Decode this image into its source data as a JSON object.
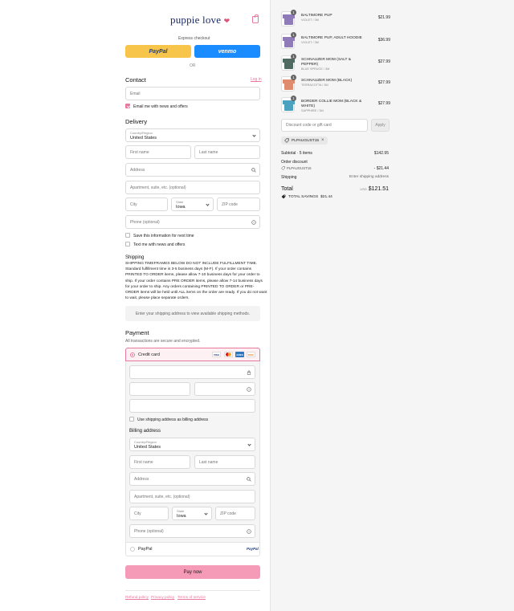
{
  "header": {
    "logo": "puppie love",
    "paw": "❤"
  },
  "express": {
    "label": "Express checkout",
    "paypal": "PayPal",
    "venmo": "venmo",
    "or": "OR"
  },
  "contact": {
    "title": "Contact",
    "login": "Log in",
    "email_placeholder": "Email",
    "newsletter": "Email me with news and offers"
  },
  "delivery": {
    "title": "Delivery",
    "country_label": "Country/Region",
    "country": "United States",
    "first": "First name",
    "last": "Last name",
    "address": "Address",
    "apt": "Apartment, suite, etc. (optional)",
    "city": "City",
    "state_label": "State",
    "state": "Iowa",
    "zip": "ZIP code",
    "phone": "Phone (optional)",
    "save_info": "Save this information for next time",
    "text_me": "Text me with news and offers"
  },
  "shipping": {
    "title": "Shipping",
    "notice_lines": [
      "SHIPPING TIMEFRAMES BELOW DO NOT INCLUDE FULFILLMENT TIME.",
      "Standard fulfillment time is 3-5 business days (M-F). If your order contains",
      "PRINTED TO ORDER items, please allow 7-10 business days for your order to",
      "ship. If your order contains PRE ORDER items, please allow 7-14 business days",
      "for your order to ship. Any orders containing PRINTED TO ORDER or PRE-",
      "ORDER items will be held until ALL items on the order are ready. If you do not want",
      "to wait, please place separate orders."
    ],
    "placeholder": "Enter your shipping address to view available shipping methods."
  },
  "payment": {
    "title": "Payment",
    "subtitle": "All transactions are secure and encrypted.",
    "credit_card": "Credit card",
    "cards": [
      "VISA",
      "MC",
      "AMEX",
      "DISC"
    ],
    "billing_same": "Use shipping address as billing address",
    "billing_title": "Billing address",
    "paypal_option": "PayPal",
    "paypal_logo": "PayPal",
    "pay_now": "Pay now"
  },
  "footer": {
    "links": [
      "Refund policy",
      "Privacy policy",
      "Terms of service"
    ]
  },
  "cart": {
    "items": [
      {
        "name": "BALTIMORE PUP",
        "variant": "VIOLET / 3M",
        "price": "$21.99",
        "qty": "1",
        "color": "#8e7bb8"
      },
      {
        "name": "BALTIMORE PUP, ADULT HOODIE",
        "variant": "VIOLET / 3M",
        "price": "$36.99",
        "qty": "1",
        "color": "#8e7bb8"
      },
      {
        "name": "SCHNAUZER MOM (SALT & PEPPER)",
        "variant": "BLUE SPRUCE / 3M",
        "price": "$27.99",
        "qty": "1",
        "color": "#4f6b61"
      },
      {
        "name": "SCHNAUZER MOM (BLACK)",
        "variant": "TERRACOTTA / 3M",
        "price": "$27.99",
        "qty": "1",
        "color": "#df8b6d"
      },
      {
        "name": "BORDER COLLIE MOM (BLACK & WHITE)",
        "variant": "SAPPHIRE / 3M",
        "price": "$27.99",
        "qty": "1",
        "color": "#4aa2c0"
      }
    ],
    "discount_placeholder": "Discount code or gift card",
    "apply": "Apply",
    "code": "PLPAUGUST15",
    "subtotal_label": "Subtotal · 5 items",
    "subtotal": "$142.95",
    "order_discount": "Order discount",
    "discount_code": "PLPAUGUST15",
    "discount_amount": "- $21.44",
    "shipping_label": "Shipping",
    "shipping_value": "Enter shipping address",
    "total_label": "Total",
    "currency": "USD",
    "total": "$121.51",
    "savings_label": "TOTAL SAVINGS",
    "savings": "$21.44"
  }
}
